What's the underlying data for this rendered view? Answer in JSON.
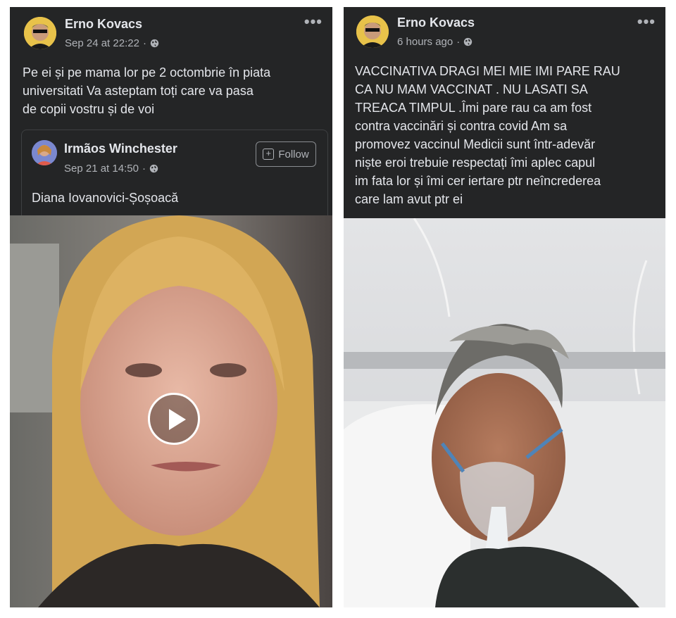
{
  "left_post": {
    "author": "Erno Kovacs",
    "timestamp": "Sep 24 at 22:22",
    "separator": "·",
    "privacy_icon": "globe-icon",
    "more_icon": "more-options-icon",
    "more_label": "•••",
    "text": "Pe ei  și pe  mama lor   pe 2  octombrie  în piata\nuniversitati  Va asteptam  toți  care    va pasa\nde copii vostru   și    de voi",
    "shared": {
      "author": "Irmãos Winchester",
      "timestamp": "Sep 21 at 14:50",
      "separator": "·",
      "follow_label": "Follow",
      "follow_icon": "follow-icon",
      "caption": "Diana Iovanovici-Șoșoacă"
    },
    "media": {
      "type": "video",
      "play_icon": "play-icon"
    }
  },
  "right_post": {
    "author": "Erno Kovacs",
    "timestamp": "6 hours ago",
    "separator": "·",
    "privacy_icon": "globe-icon",
    "more_icon": "more-options-icon",
    "more_label": "•••",
    "text": "VACCINATIVA  DRAGI MEI    MIE IMI PARE RAU\nCA NU  MAM VACCINAT . NU LASATI SA\nTREACA TIMPUL .Îmi pare rau  ca  am fost\ncontra vaccinări și contra covid   Am sa\npromovez vaccinul  Medicii  sunt  într-adevăr\nniște eroi  trebuie respectați  îmi  aplec capul\nim fata lor și îmi cer iertare ptr  neîncrederea\ncare lam avut    ptr ei",
    "media": {
      "type": "photo"
    }
  },
  "colors": {
    "card_bg": "#242526",
    "primary_text": "#e4e6eb",
    "secondary_text": "#b0b3b8",
    "divider": "#3e4042"
  }
}
